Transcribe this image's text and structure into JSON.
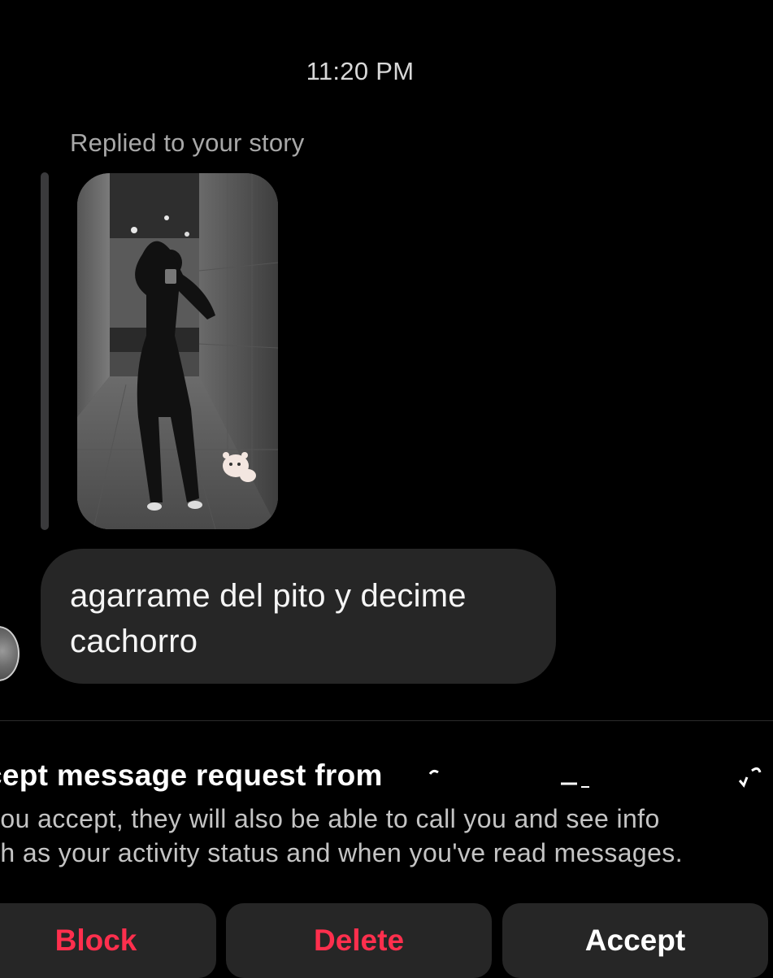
{
  "thread": {
    "timestamp": "11:20 PM",
    "reply_context": "Replied to your story",
    "message_text": "agarrame del pito y decime cachorro"
  },
  "request": {
    "title": "cept message request from",
    "body_lines": [
      "you accept, they will also be able to call you and see info",
      "ch as your activity status and when you've read messages."
    ]
  },
  "actions": {
    "block_label": "Block",
    "delete_label": "Delete",
    "accept_label": "Accept"
  },
  "colors": {
    "background": "#000000",
    "bubble": "#262626",
    "danger": "#ff2f4d",
    "muted_text": "#a8a8a8"
  },
  "icons": {
    "avatar": "avatar-icon",
    "sticker": "bear-sticker-icon"
  }
}
